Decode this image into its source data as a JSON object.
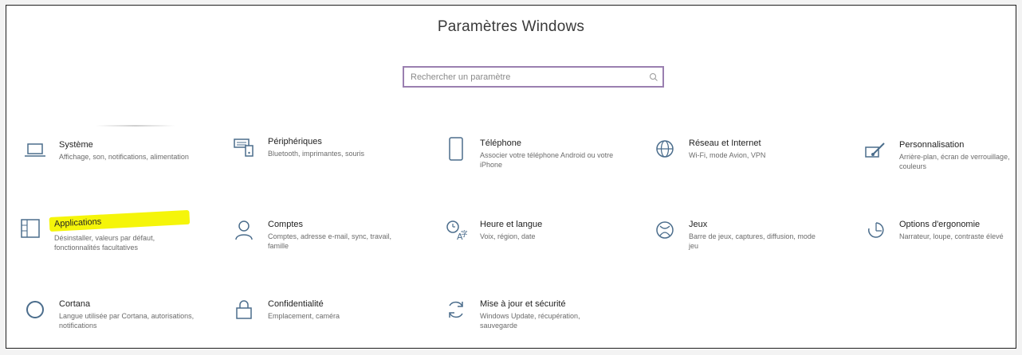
{
  "window": {
    "title": "Paramètres Windows"
  },
  "search": {
    "placeholder": "Rechercher un paramètre"
  },
  "accent": "#9a7fb0",
  "highlight_color": "#f5f50a",
  "tiles": [
    {
      "title": "Système",
      "desc": "Affichage, son, notifications, alimentation",
      "icon": "laptop-icon"
    },
    {
      "title": "Périphériques",
      "desc": "Bluetooth, imprimantes, souris",
      "icon": "keyboard-devices-icon"
    },
    {
      "title": "Téléphone",
      "desc": "Associer votre téléphone Android ou votre iPhone",
      "icon": "phone-icon"
    },
    {
      "title": "Réseau et Internet",
      "desc": "Wi-Fi, mode Avion, VPN",
      "icon": "globe-icon"
    },
    {
      "title": "Personnalisation",
      "desc": "Arrière-plan, écran de verrouillage, couleurs",
      "icon": "brush-icon"
    },
    {
      "title": "Applications",
      "desc": "Désinstaller, valeurs par défaut, fonctionnalités facultatives",
      "icon": "apps-list-icon"
    },
    {
      "title": "Comptes",
      "desc": "Comptes, adresse e-mail, sync, travail, famille",
      "icon": "person-icon"
    },
    {
      "title": "Heure et langue",
      "desc": "Voix, région, date",
      "icon": "time-language-icon"
    },
    {
      "title": "Jeux",
      "desc": "Barre de jeux, captures, diffusion, mode jeu",
      "icon": "xbox-icon"
    },
    {
      "title": "Options d'ergonomie",
      "desc": "Narrateur, loupe, contraste élevé",
      "icon": "ease-of-access-icon"
    },
    {
      "title": "Cortana",
      "desc": "Langue utilisée par Cortana, autorisations, notifications",
      "icon": "cortana-circle-icon"
    },
    {
      "title": "Confidentialité",
      "desc": "Emplacement, caméra",
      "icon": "lock-icon"
    },
    {
      "title": "Mise à jour et sécurité",
      "desc": "Windows Update, récupération, sauvegarde",
      "icon": "update-sync-icon"
    }
  ]
}
